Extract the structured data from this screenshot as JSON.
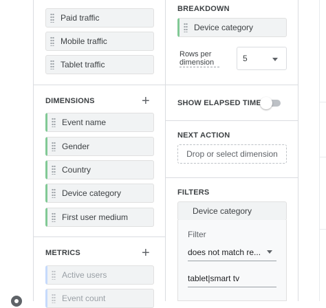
{
  "variables_panel": {
    "segments": [
      {
        "label": "Paid traffic"
      },
      {
        "label": "Mobile traffic"
      },
      {
        "label": "Tablet traffic"
      }
    ],
    "dimensions": {
      "title": "DIMENSIONS",
      "add_symbol": "+",
      "items": [
        {
          "label": "Event name"
        },
        {
          "label": "Gender"
        },
        {
          "label": "Country"
        },
        {
          "label": "Device category"
        },
        {
          "label": "First user medium"
        }
      ]
    },
    "metrics": {
      "title": "METRICS",
      "add_symbol": "+",
      "items": [
        {
          "label": "Active users"
        },
        {
          "label": "Event count"
        }
      ]
    }
  },
  "settings_panel": {
    "breakdown": {
      "title": "BREAKDOWN",
      "chip_label": "Device category"
    },
    "rows_per_dimension": {
      "label": "Rows per dimension",
      "value": "5"
    },
    "elapsed_time": {
      "label": "SHOW ELAPSED TIME",
      "enabled": false
    },
    "next_action": {
      "title": "NEXT ACTION",
      "dropzone_text": "Drop or select dimension"
    },
    "filters": {
      "title": "FILTERS",
      "chip_label": "Device category",
      "filter_label": "Filter",
      "condition": "does not match re...",
      "value": "tablet|smart tv"
    }
  },
  "icons": {
    "settings": "gear-icon",
    "drag": "drag-handle-icon",
    "dropdown": "chevron-down-icon"
  },
  "colors": {
    "dimension_accent": "#81c995",
    "metric_accent": "#c6dafc"
  }
}
